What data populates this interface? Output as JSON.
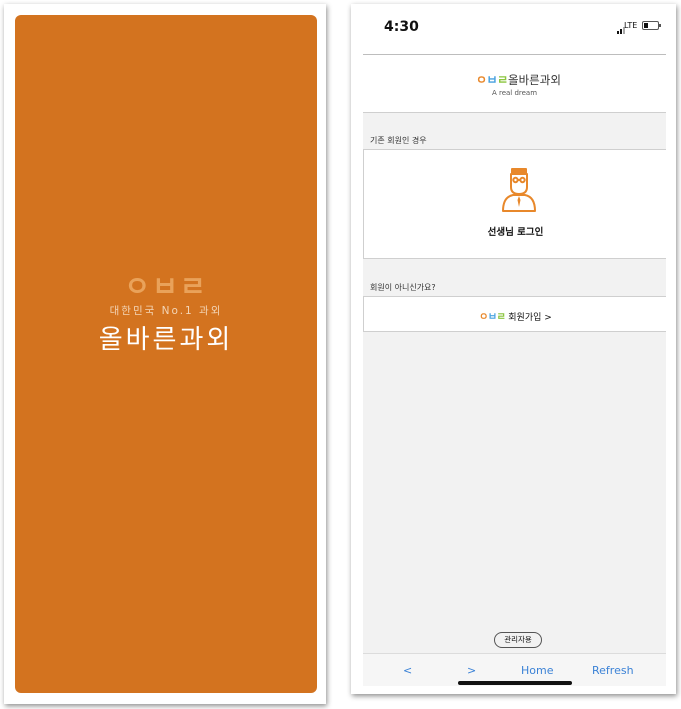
{
  "splash": {
    "logo_text": "ㅇㅂㄹ",
    "tagline": "대한민국 No.1 과외",
    "brand": "올바른과외"
  },
  "status_bar": {
    "time": "4:30",
    "network": "LTE"
  },
  "header": {
    "logo_parts": [
      "ㅇ",
      "ㅂ",
      "ㄹ"
    ],
    "title": "올바른과외",
    "subtitle": "A real dream"
  },
  "existing_member": {
    "section_label": "기존 회원인 경우",
    "teacher_login_label": "선생님 로그인"
  },
  "new_member": {
    "section_label": "회원이 아니신가요?",
    "signup_label": "회원가입 >"
  },
  "admin_button": "관리자용",
  "bottom_nav": {
    "back": "<",
    "forward": ">",
    "home": "Home",
    "refresh": "Refresh"
  },
  "colors": {
    "splash_background": "#d3731f",
    "logo_orange": "#e8882b",
    "logo_blue": "#4aa3e0",
    "logo_green": "#8cc63f",
    "nav_link": "#3b82d6"
  }
}
